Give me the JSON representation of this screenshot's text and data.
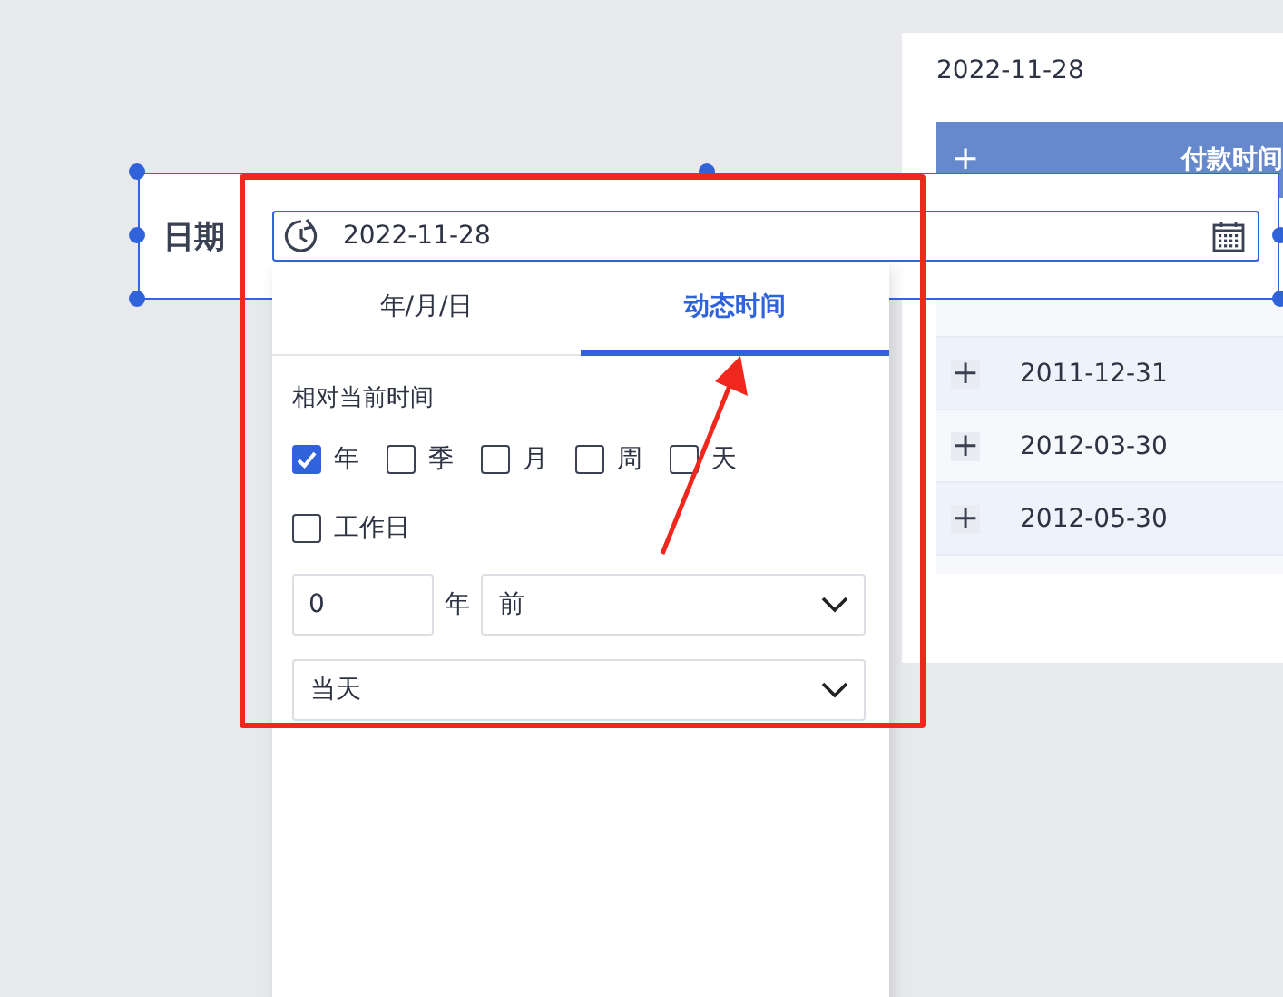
{
  "table_panel": {
    "date": "2022-11-28",
    "header": {
      "expand": "+",
      "column": "付款时间"
    },
    "rows": [
      {
        "expand": "+",
        "date": "2011-12-31"
      },
      {
        "expand": "+",
        "date": "2012-03-30"
      },
      {
        "expand": "+",
        "date": "2012-05-30"
      }
    ]
  },
  "widget": {
    "label": "日期",
    "field": {
      "value": "2022-11-28"
    }
  },
  "picker": {
    "tabs": [
      {
        "label": "年/月/日",
        "selected": false
      },
      {
        "label": "动态时间",
        "selected": true
      }
    ],
    "section_title": "相对当前时间",
    "units": [
      {
        "label": "年",
        "checked": true
      },
      {
        "label": "季",
        "checked": false
      },
      {
        "label": "月",
        "checked": false
      },
      {
        "label": "周",
        "checked": false
      },
      {
        "label": "天",
        "checked": false
      }
    ],
    "workday": {
      "label": "工作日",
      "checked": false
    },
    "offset": {
      "value": "0",
      "unit": "年",
      "direction": "前"
    },
    "anchor": "当天"
  }
}
